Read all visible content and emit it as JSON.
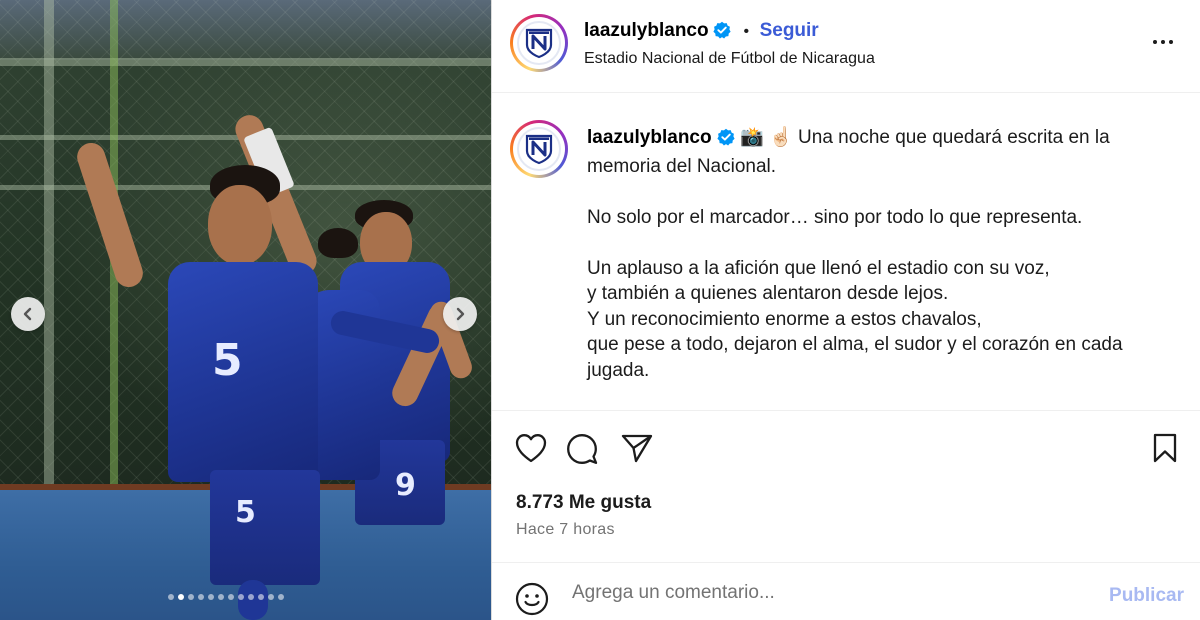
{
  "post": {
    "username": "laazulyblanco",
    "follow_separator": "•",
    "follow_label": "Seguir",
    "location": "Estadio Nacional de Fútbol de Nicaragua",
    "more_icon": "more-horizontal-icon"
  },
  "media": {
    "player_numbers": {
      "front_jersey": "5",
      "front_shorts": "5",
      "back_shorts": "9"
    },
    "carousel": {
      "total_slides": 12,
      "active_slide": 2
    }
  },
  "caption": {
    "username": "laazulyblanco",
    "emojis": "📸 ☝🏻",
    "first_line": "Una noche que quedará escrita en la memoria del Nacional.",
    "paragraphs": [
      [
        "No solo por el marcador… sino por todo lo que representa."
      ],
      [
        "Un aplauso a la afición que llenó el estadio con su voz,",
        "y también a quienes alentaron desde lejos.",
        "Y un reconocimiento enorme a estos chavalos,",
        "que pese a todo, dejaron el alma, el sudor y el corazón en cada jugada."
      ]
    ]
  },
  "engagement": {
    "likes": "8.773 Me gusta",
    "timestamp": "Hace 7 horas"
  },
  "comment": {
    "placeholder": "Agrega un comentario...",
    "publish_label": "Publicar"
  },
  "colors": {
    "link_blue": "#3b5bd6",
    "verified_blue": "#0095f6",
    "publish_disabled": "#a8b9f2",
    "secondary_text": "#737373"
  }
}
